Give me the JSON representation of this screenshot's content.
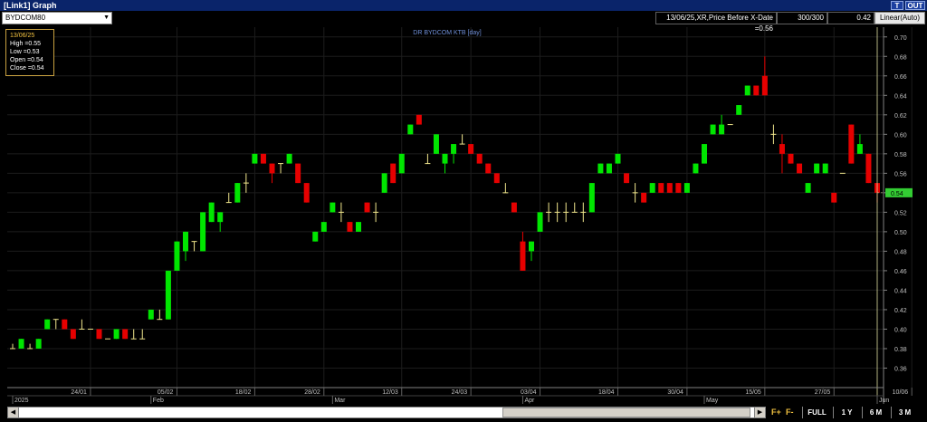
{
  "window": {
    "title": "[Link1] Graph",
    "btn_t": "T",
    "btn_out": "OUT"
  },
  "toolbar": {
    "symbol": "BYDCOM80",
    "info": "13/06/25,XR,Price Before X-Date =0.56",
    "count": "300/300",
    "last_price": "0.42",
    "scale_mode": "Linear(Auto)"
  },
  "tooltip": {
    "date": "13/06/25",
    "high": "High =0.55",
    "low": "Low =0.53",
    "open": "Open =0.54",
    "close": "Close =0.54"
  },
  "price_tag": "0.54",
  "bottom": {
    "zoom_in": "F+",
    "zoom_out": "F-",
    "ranges": [
      "FULL",
      "1 Y",
      "6 M",
      "3 M"
    ]
  },
  "colors": {
    "up": "#00e600",
    "down": "#e60000",
    "neutral": "#f0e68c",
    "grid": "#1c1c1c",
    "axis_text": "#c0c0c0",
    "title": "#6f8fd8",
    "crosshair": "#e0e0a0",
    "price_tag_bg": "#33cc33"
  },
  "chart_data": {
    "type": "candlestick",
    "title": "DR BYDCOM KTB [day]",
    "ylim": [
      0.34,
      0.71
    ],
    "y_ticks": [
      "0.36",
      "0.38",
      "0.40",
      "0.42",
      "0.44",
      "0.46",
      "0.48",
      "0.50",
      "0.52",
      "0.54",
      "0.56",
      "0.58",
      "0.60",
      "0.62",
      "0.64",
      "0.66",
      "0.68",
      "0.70"
    ],
    "x_labels": [
      {
        "label": "24/01",
        "index": 9
      },
      {
        "label": "05/02",
        "index": 19
      },
      {
        "label": "18/02",
        "index": 28
      },
      {
        "label": "28/02",
        "index": 36
      },
      {
        "label": "12/03",
        "index": 45
      },
      {
        "label": "24/03",
        "index": 53
      },
      {
        "label": "03/04",
        "index": 61
      },
      {
        "label": "18/04",
        "index": 70
      },
      {
        "label": "30/04",
        "index": 78
      },
      {
        "label": "15/05",
        "index": 87
      },
      {
        "label": "27/05",
        "index": 95
      },
      {
        "label": "10/06",
        "index": 104
      }
    ],
    "x_sublabels": [
      {
        "label": "2025",
        "index": 0
      },
      {
        "label": "Feb",
        "index": 16
      },
      {
        "label": "Mar",
        "index": 37
      },
      {
        "label": "Apr",
        "index": 59
      },
      {
        "label": "May",
        "index": 80
      },
      {
        "label": "Jun",
        "index": 100
      }
    ],
    "ohlc": [
      [
        0.38,
        0.385,
        0.38,
        0.38
      ],
      [
        0.38,
        0.39,
        0.38,
        0.39
      ],
      [
        0.38,
        0.385,
        0.38,
        0.38
      ],
      [
        0.38,
        0.39,
        0.38,
        0.39
      ],
      [
        0.4,
        0.41,
        0.4,
        0.41
      ],
      [
        0.41,
        0.41,
        0.4,
        0.41
      ],
      [
        0.41,
        0.41,
        0.4,
        0.4
      ],
      [
        0.4,
        0.4,
        0.39,
        0.39
      ],
      [
        0.4,
        0.41,
        0.4,
        0.4
      ],
      [
        0.4,
        0.4,
        0.4,
        0.4
      ],
      [
        0.4,
        0.4,
        0.39,
        0.39
      ],
      [
        0.39,
        0.39,
        0.39,
        0.39
      ],
      [
        0.39,
        0.4,
        0.39,
        0.4
      ],
      [
        0.4,
        0.4,
        0.39,
        0.39
      ],
      [
        0.39,
        0.4,
        0.39,
        0.39
      ],
      [
        0.39,
        0.4,
        0.39,
        0.39
      ],
      [
        0.41,
        0.42,
        0.41,
        0.42
      ],
      [
        0.41,
        0.42,
        0.41,
        0.41
      ],
      [
        0.41,
        0.46,
        0.41,
        0.46
      ],
      [
        0.46,
        0.49,
        0.46,
        0.49
      ],
      [
        0.48,
        0.5,
        0.47,
        0.5
      ],
      [
        0.49,
        0.49,
        0.48,
        0.49
      ],
      [
        0.48,
        0.52,
        0.48,
        0.52
      ],
      [
        0.51,
        0.53,
        0.51,
        0.53
      ],
      [
        0.51,
        0.52,
        0.5,
        0.52
      ],
      [
        0.53,
        0.54,
        0.53,
        0.53
      ],
      [
        0.53,
        0.55,
        0.53,
        0.55
      ],
      [
        0.55,
        0.56,
        0.54,
        0.55
      ],
      [
        0.57,
        0.58,
        0.57,
        0.58
      ],
      [
        0.58,
        0.58,
        0.57,
        0.57
      ],
      [
        0.57,
        0.57,
        0.55,
        0.56
      ],
      [
        0.57,
        0.57,
        0.56,
        0.57
      ],
      [
        0.57,
        0.58,
        0.57,
        0.58
      ],
      [
        0.57,
        0.57,
        0.55,
        0.55
      ],
      [
        0.55,
        0.55,
        0.53,
        0.53
      ],
      [
        0.49,
        0.5,
        0.49,
        0.5
      ],
      [
        0.5,
        0.51,
        0.5,
        0.51
      ],
      [
        0.52,
        0.53,
        0.52,
        0.53
      ],
      [
        0.52,
        0.53,
        0.51,
        0.52
      ],
      [
        0.51,
        0.51,
        0.5,
        0.5
      ],
      [
        0.5,
        0.51,
        0.5,
        0.51
      ],
      [
        0.53,
        0.53,
        0.52,
        0.52
      ],
      [
        0.52,
        0.53,
        0.51,
        0.52
      ],
      [
        0.54,
        0.56,
        0.54,
        0.56
      ],
      [
        0.57,
        0.57,
        0.55,
        0.55
      ],
      [
        0.56,
        0.58,
        0.56,
        0.58
      ],
      [
        0.6,
        0.61,
        0.6,
        0.61
      ],
      [
        0.62,
        0.62,
        0.61,
        0.61
      ],
      [
        0.57,
        0.58,
        0.57,
        0.57
      ],
      [
        0.58,
        0.6,
        0.58,
        0.6
      ],
      [
        0.57,
        0.58,
        0.56,
        0.58
      ],
      [
        0.58,
        0.59,
        0.57,
        0.59
      ],
      [
        0.59,
        0.6,
        0.59,
        0.59
      ],
      [
        0.59,
        0.59,
        0.58,
        0.58
      ],
      [
        0.58,
        0.58,
        0.57,
        0.57
      ],
      [
        0.57,
        0.57,
        0.56,
        0.56
      ],
      [
        0.56,
        0.56,
        0.55,
        0.55
      ],
      [
        0.54,
        0.55,
        0.54,
        0.54
      ],
      [
        0.53,
        0.53,
        0.52,
        0.52
      ],
      [
        0.49,
        0.5,
        0.46,
        0.46
      ],
      [
        0.48,
        0.49,
        0.47,
        0.49
      ],
      [
        0.5,
        0.52,
        0.5,
        0.52
      ],
      [
        0.52,
        0.53,
        0.51,
        0.52
      ],
      [
        0.52,
        0.53,
        0.51,
        0.52
      ],
      [
        0.52,
        0.53,
        0.51,
        0.52
      ],
      [
        0.52,
        0.53,
        0.52,
        0.52
      ],
      [
        0.52,
        0.53,
        0.51,
        0.52
      ],
      [
        0.52,
        0.55,
        0.52,
        0.55
      ],
      [
        0.56,
        0.57,
        0.56,
        0.57
      ],
      [
        0.56,
        0.57,
        0.56,
        0.57
      ],
      [
        0.57,
        0.58,
        0.57,
        0.58
      ],
      [
        0.56,
        0.56,
        0.55,
        0.55
      ],
      [
        0.54,
        0.55,
        0.53,
        0.54
      ],
      [
        0.54,
        0.54,
        0.53,
        0.53
      ],
      [
        0.54,
        0.55,
        0.54,
        0.55
      ],
      [
        0.55,
        0.55,
        0.54,
        0.54
      ],
      [
        0.55,
        0.55,
        0.54,
        0.54
      ],
      [
        0.55,
        0.55,
        0.54,
        0.54
      ],
      [
        0.54,
        0.55,
        0.54,
        0.55
      ],
      [
        0.56,
        0.57,
        0.56,
        0.57
      ],
      [
        0.57,
        0.59,
        0.57,
        0.59
      ],
      [
        0.6,
        0.61,
        0.6,
        0.61
      ],
      [
        0.6,
        0.62,
        0.6,
        0.61
      ],
      [
        0.61,
        0.61,
        0.61,
        0.61
      ],
      [
        0.62,
        0.63,
        0.62,
        0.63
      ],
      [
        0.64,
        0.65,
        0.64,
        0.65
      ],
      [
        0.65,
        0.65,
        0.64,
        0.64
      ],
      [
        0.66,
        0.68,
        0.64,
        0.64
      ],
      [
        0.6,
        0.61,
        0.59,
        0.6
      ],
      [
        0.59,
        0.6,
        0.56,
        0.58
      ],
      [
        0.58,
        0.58,
        0.57,
        0.57
      ],
      [
        0.57,
        0.57,
        0.56,
        0.56
      ],
      [
        0.54,
        0.55,
        0.54,
        0.55
      ],
      [
        0.56,
        0.57,
        0.56,
        0.57
      ],
      [
        0.56,
        0.57,
        0.56,
        0.57
      ],
      [
        0.54,
        0.54,
        0.53,
        0.53
      ],
      [
        0.56,
        0.56,
        0.56,
        0.56
      ],
      [
        0.61,
        0.61,
        0.57,
        0.57
      ],
      [
        0.58,
        0.6,
        0.58,
        0.59
      ],
      [
        0.58,
        0.58,
        0.55,
        0.55
      ],
      [
        0.55,
        0.55,
        0.53,
        0.54
      ]
    ]
  }
}
